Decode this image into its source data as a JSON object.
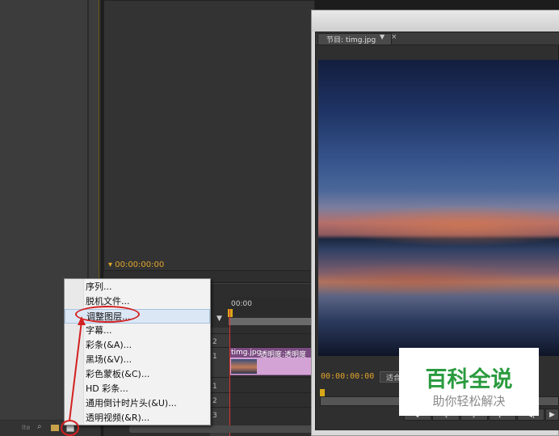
{
  "source_monitor": {
    "timecode": "00:00:00:00"
  },
  "timeline": {
    "timecode": "00:00",
    "tracks": [
      "2",
      "1",
      "1",
      "2",
      "3"
    ],
    "clip_name": "timg.jpg",
    "clip_effect": "透明度:透明度"
  },
  "program_monitor": {
    "tab_label": "节目: timg.jpg",
    "timecode": "00:00:00:00",
    "fit_label": "适合"
  },
  "context_menu": {
    "items": [
      "序列...",
      "脱机文件...",
      "调整图层...",
      "字幕...",
      "彩条(&A)...",
      "黑场(&V)...",
      "彩色蒙板(&C)...",
      "HD 彩条...",
      "通用倒计时片头(&U)...",
      "透明视频(&R)..."
    ],
    "highlighted_index": 2
  },
  "project_panel": {
    "bottom_label": "Ite"
  },
  "watermark": {
    "title": "百科全说",
    "subtitle": "助你轻松解决"
  },
  "colors": {
    "timecode": "#e2a52c",
    "annotation": "#d32020",
    "clip": "#d4a3d6",
    "watermark_green": "#2a9b3f"
  }
}
